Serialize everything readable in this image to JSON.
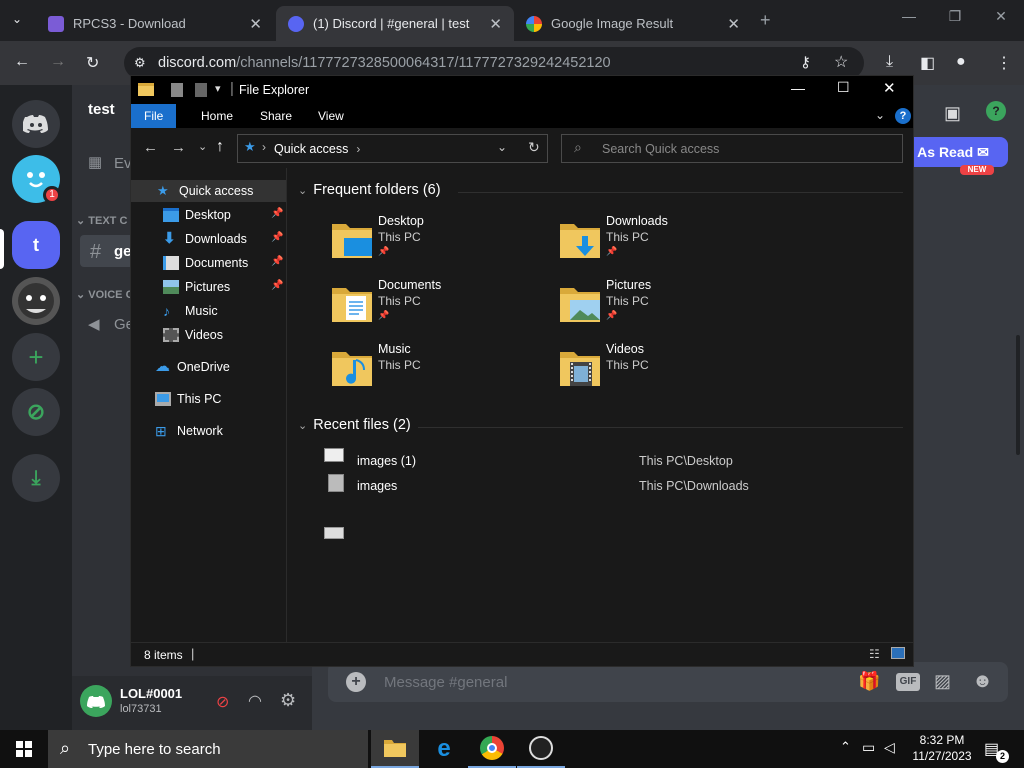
{
  "browser": {
    "tabs": [
      {
        "title": "RPCS3 - Download",
        "active": false
      },
      {
        "title": "(1) Discord | #general | test",
        "active": true
      },
      {
        "title": "Google Image Result",
        "active": false
      }
    ],
    "new_tab": "+",
    "url_host": "discord.com",
    "url_path": "/channels/1177727328500064317/1177727329242452120"
  },
  "discord": {
    "server_name": "test",
    "events_label": "Ev",
    "text_category": "TEXT C",
    "channel_hash": "#",
    "channel_name": "ge",
    "voice_category": "VOICE C",
    "voice_channel": "Ge",
    "server_initial": "t",
    "dm_badge": "1",
    "mark_read": "k As Read",
    "new_badge": "NEW",
    "username": "LOL#0001",
    "user_tag": "lol73731",
    "message_placeholder": "Message #general",
    "gif_label": "GIF"
  },
  "explorer": {
    "title": "File Explorer",
    "ribbon_tabs": [
      "File",
      "Home",
      "Share",
      "View"
    ],
    "help": "?",
    "breadcrumb": "Quick access",
    "search_placeholder": "Search Quick access",
    "nav": [
      {
        "label": "Quick access",
        "icon": "star-icon",
        "pinned": false
      },
      {
        "label": "Desktop",
        "icon": "desktop-folder-icon",
        "pinned": true
      },
      {
        "label": "Downloads",
        "icon": "downloads-icon",
        "pinned": true
      },
      {
        "label": "Documents",
        "icon": "documents-icon",
        "pinned": true
      },
      {
        "label": "Pictures",
        "icon": "pictures-icon",
        "pinned": true
      },
      {
        "label": "Music",
        "icon": "music-icon",
        "pinned": false
      },
      {
        "label": "Videos",
        "icon": "videos-icon",
        "pinned": false
      },
      {
        "label": "OneDrive",
        "icon": "cloud-icon",
        "pinned": false
      },
      {
        "label": "This PC",
        "icon": "computer-icon",
        "pinned": false
      },
      {
        "label": "Network",
        "icon": "network-icon",
        "pinned": false
      }
    ],
    "frequent_title": "Frequent folders (6)",
    "folders": [
      {
        "name": "Desktop",
        "location": "This PC",
        "pinned": true
      },
      {
        "name": "Downloads",
        "location": "This PC",
        "pinned": true
      },
      {
        "name": "Documents",
        "location": "This PC",
        "pinned": true
      },
      {
        "name": "Pictures",
        "location": "This PC",
        "pinned": true
      },
      {
        "name": "Music",
        "location": "This PC",
        "pinned": false
      },
      {
        "name": "Videos",
        "location": "This PC",
        "pinned": false
      }
    ],
    "recent_title": "Recent files (2)",
    "recent": [
      {
        "name": "images (1)",
        "path": "This PC\\Desktop"
      },
      {
        "name": "images",
        "path": "This PC\\Downloads"
      }
    ],
    "status": "8 items"
  },
  "taskbar": {
    "search_placeholder": "Type here to search",
    "time": "8:32 PM",
    "date": "11/27/2023",
    "notif_count": "2"
  },
  "colors": {
    "discord_blurple": "#5865f2",
    "discord_green": "#3ba55d",
    "explorer_file_tab": "#1a6fcc",
    "folder_yellow": "#f0c75e"
  }
}
